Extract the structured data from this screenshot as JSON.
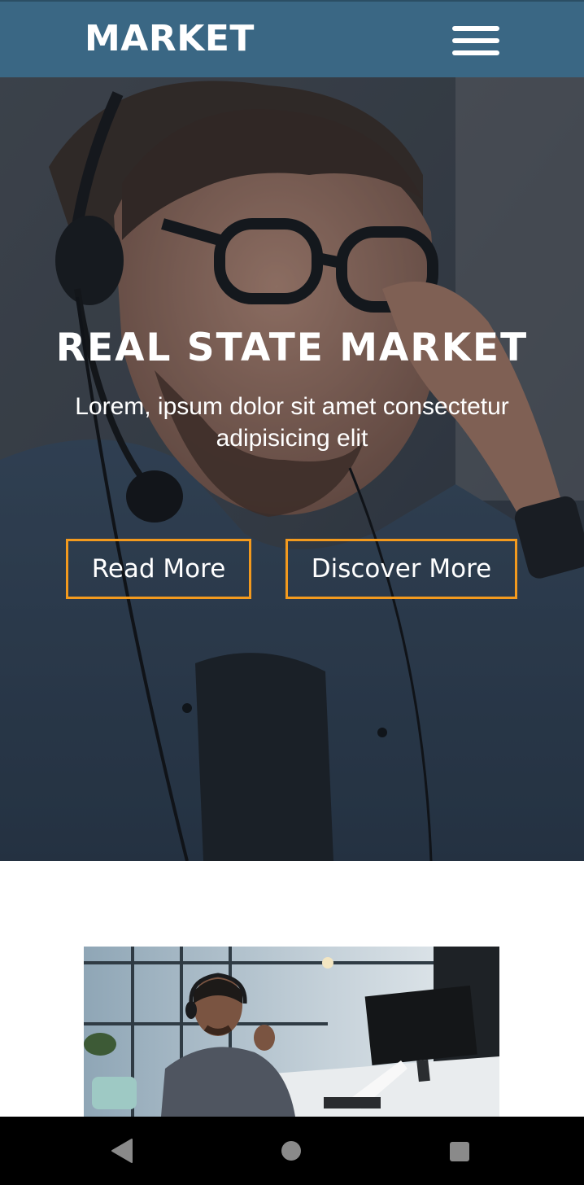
{
  "header": {
    "brand": "MARKET",
    "menu_icon": "hamburger-menu-icon",
    "background_color": "#3a6784"
  },
  "hero": {
    "title": "REAL STATE MARKET",
    "subtitle": "Lorem, ipsum dolor sit amet consectetur adipisicing elit",
    "buttons": [
      {
        "label": "Read More"
      },
      {
        "label": "Discover More"
      }
    ],
    "button_border_color": "#f39a1e",
    "image": "man-with-headset-photo"
  },
  "content": {
    "image": "office-call-center-photo"
  },
  "system_nav": {
    "back_icon": "back-triangle-icon",
    "home_icon": "home-circle-icon",
    "recent_icon": "recent-apps-square-icon"
  }
}
